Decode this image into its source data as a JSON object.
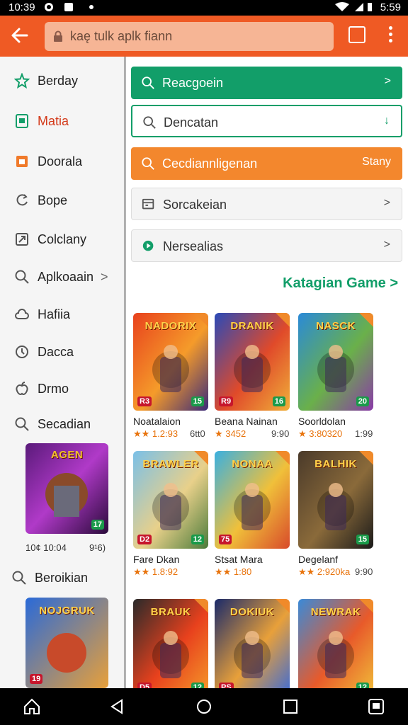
{
  "status": {
    "time": "10:39",
    "right": "5:59"
  },
  "search": {
    "text": "kaę tulk aplk fiann"
  },
  "sidebar": {
    "items": [
      {
        "label": "Berday",
        "icon": "star-outline-icon"
      },
      {
        "label": "Matia",
        "icon": "tablet-icon",
        "active": true
      },
      {
        "label": "Doorala",
        "icon": "orange-square-icon"
      },
      {
        "label": "Bope",
        "icon": "refresh-icon"
      },
      {
        "label": "Colclany",
        "icon": "share-box-icon"
      },
      {
        "label": "Aplkoaain",
        "icon": "search-icon",
        "chevron": ">"
      },
      {
        "label": "Hafiia",
        "icon": "cloud-icon"
      },
      {
        "label": "Dacca",
        "icon": "clock-icon"
      },
      {
        "label": "Drmo",
        "icon": "apple-icon"
      },
      {
        "label": "Secadian",
        "icon": "search-icon"
      }
    ],
    "featured": {
      "meta_left": "10¢ 10:04",
      "meta_right": "9¹6)",
      "art_title": "AGEN",
      "badge_right": "17"
    },
    "section2": {
      "label": "Beroikian",
      "icon": "search-icon"
    },
    "featured2": {
      "art_title": "NOJGRUK",
      "badge_left": "19"
    }
  },
  "actions": [
    {
      "label": "Reacgoein",
      "icon": "search-icon",
      "trailing": ">",
      "style": "green"
    },
    {
      "label": "Dencatan",
      "icon": "search-icon",
      "trailing": "↓",
      "style": "outline-green"
    },
    {
      "label": "Cecdiannligenan",
      "icon": "search-icon",
      "trailing": "Stany",
      "style": "orange"
    },
    {
      "label": "Sorcakeian",
      "icon": "calendar-icon",
      "trailing": ">",
      "style": "grey"
    },
    {
      "label": "Nersealias",
      "icon": "play-circle-icon",
      "trailing": ">",
      "style": "grey"
    }
  ],
  "section_title": "Katagian Game >",
  "games": [
    {
      "name": "Noatalaion",
      "rating": "★★ 1.2:93",
      "extra": "6tt0",
      "art": "NADORIX",
      "bl": "R3",
      "br": "15",
      "colors": [
        "#e8411d",
        "#f59b2a",
        "#3a2a7a"
      ]
    },
    {
      "name": "Beana Nainan",
      "rating": "★ 3452",
      "extra": "9:90",
      "art": "DRANIK",
      "bl": "R9",
      "br": "16",
      "colors": [
        "#2a4ab8",
        "#e04a2a",
        "#f0b03a"
      ]
    },
    {
      "name": "Soorldolan",
      "rating": "★ 3:80320",
      "extra": "1:99",
      "art": "NASCK",
      "bl": "",
      "br": "20",
      "colors": [
        "#2a8ad8",
        "#6ab04a",
        "#8a3aa8"
      ]
    },
    {
      "name": "Fare Dkan",
      "rating": "★★ 1.8:92",
      "extra": "",
      "art": "BRAWLER",
      "bl": "D2",
      "br": "12",
      "colors": [
        "#7ac0e8",
        "#e8d08a",
        "#4a7a3a"
      ]
    },
    {
      "name": "Stsat Mara",
      "rating": "★★ 1:80",
      "extra": "",
      "art": "NONAA",
      "bl": "75",
      "br": "",
      "colors": [
        "#3ab0e0",
        "#f0c03a",
        "#d84a2a"
      ]
    },
    {
      "name": "Degelanf",
      "rating": "★★ 2:920ka",
      "extra": "9:90",
      "art": "BALHIK",
      "bl": "",
      "br": "15",
      "colors": [
        "#4a3a2a",
        "#8a6a3a",
        "#1a1a1a"
      ]
    },
    {
      "name": "",
      "rating": "",
      "extra": "",
      "art": "BRAUK",
      "bl": "D5",
      "br": "12",
      "colors": [
        "#2a2a2a",
        "#e8411d",
        "#f59b2a"
      ]
    },
    {
      "name": "",
      "rating": "",
      "extra": "",
      "art": "DOKIUK",
      "bl": "PS",
      "br": "",
      "colors": [
        "#1a2a6a",
        "#e8a03a",
        "#3a6ad8"
      ]
    },
    {
      "name": "",
      "rating": "",
      "extra": "",
      "art": "NEWRAK",
      "bl": "",
      "br": "12",
      "colors": [
        "#3a8ad8",
        "#e85a2a",
        "#f0c03a"
      ]
    }
  ]
}
